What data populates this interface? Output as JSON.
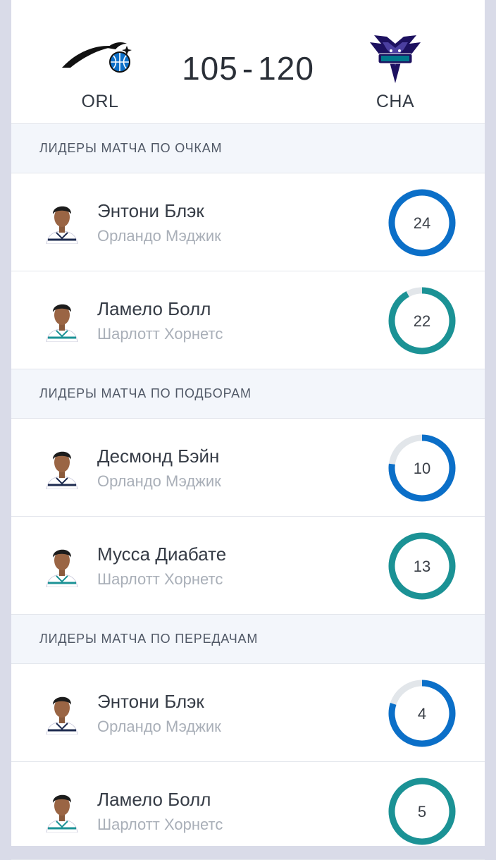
{
  "match": {
    "home": {
      "abbr": "ORL",
      "logo_icon": "orlando-magic-logo-icon"
    },
    "away": {
      "abbr": "CHA",
      "logo_icon": "charlotte-hornets-logo-icon"
    },
    "home_score": "105",
    "separator": "-",
    "away_score": "120"
  },
  "colors": {
    "orl": "#0b6fc8",
    "cha": "#1b9295",
    "ring_bg": "#e2e6ea"
  },
  "sections": [
    {
      "title": "ЛИДЕРЫ МАТЧА ПО ОЧКАМ",
      "players": [
        {
          "name": "Энтони Блэк",
          "team": "Орландо Мэджик",
          "value": "24",
          "fill": 1.0,
          "team_code": "orl"
        },
        {
          "name": "Ламело Болл",
          "team": "Шарлотт Хорнетс",
          "value": "22",
          "fill": 0.92,
          "team_code": "cha"
        }
      ]
    },
    {
      "title": "ЛИДЕРЫ МАТЧА ПО ПОДБОРАМ",
      "players": [
        {
          "name": "Десмонд Бэйн",
          "team": "Орландо Мэджик",
          "value": "10",
          "fill": 0.77,
          "team_code": "orl"
        },
        {
          "name": "Мусса Диабате",
          "team": "Шарлотт Хорнетс",
          "value": "13",
          "fill": 1.0,
          "team_code": "cha"
        }
      ]
    },
    {
      "title": "ЛИДЕРЫ МАТЧА ПО ПЕРЕДАЧАМ",
      "players": [
        {
          "name": "Энтони Блэк",
          "team": "Орландо Мэджик",
          "value": "4",
          "fill": 0.8,
          "team_code": "orl"
        },
        {
          "name": "Ламело Болл",
          "team": "Шарлотт Хорнетс",
          "value": "5",
          "fill": 1.0,
          "team_code": "cha"
        }
      ]
    }
  ]
}
